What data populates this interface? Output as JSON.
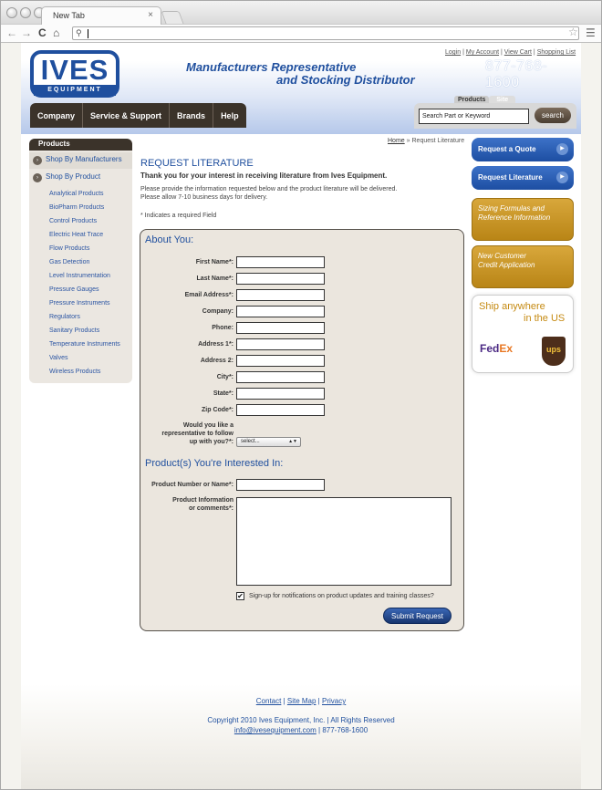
{
  "browser": {
    "tab_title": "New Tab",
    "tab_close": "×",
    "back": "←",
    "forward": "→",
    "reload": "C",
    "home": "⌂",
    "search_glyph": "⚲",
    "star": "☆",
    "menu": "☰"
  },
  "header": {
    "logo_main": "IVES",
    "logo_sub": "EQUIPMENT",
    "tagline_1": "Manufacturers Representative",
    "tagline_2": "and Stocking Distributor",
    "top_links": [
      "Login",
      "My Account",
      "View Cart",
      "Shopping List"
    ],
    "phone": "877-768-1600"
  },
  "nav": {
    "items": [
      "Company",
      "Service & Support",
      "Brands",
      "Help"
    ]
  },
  "search": {
    "tab_products": "Products",
    "tab_site": "Site",
    "placeholder": "Search Part or Keyword",
    "button": "search"
  },
  "sidebar": {
    "heading": "Products",
    "shop_manufacturers": "Shop By Manufacturers",
    "shop_product": "Shop By Product",
    "bullet": "›",
    "items": [
      "Analytical Products",
      "BioPharm Products",
      "Control Products",
      "Electric Heat Trace",
      "Flow Products",
      "Gas Detection",
      "Level Instrumentation",
      "Pressure Gauges",
      "Pressure Instruments",
      "Regulators",
      "Sanitary Products",
      "Temperature Instruments",
      "Valves",
      "Wireless Products"
    ]
  },
  "breadcrumb": {
    "home": "Home",
    "sep": "»",
    "current": "Request Literature"
  },
  "main": {
    "title": "REQUEST LITERATURE",
    "thanks": "Thank you for your interest in receiving literature from Ives Equipment.",
    "p1": "Please provide the information requested below and the product literature will be delivered.",
    "p2": "Please allow 7-10 business days for delivery.",
    "required_note": "* Indicates a required Field"
  },
  "form": {
    "about_heading": "About You:",
    "fields": [
      "First Name*:",
      "Last Name*:",
      "Email Address*:",
      "Company:",
      "Phone:",
      "Address 1*:",
      "Address 2:",
      "City*:",
      "State*:",
      "Zip Code*:"
    ],
    "rep_label_1": "Would you like a",
    "rep_label_2": "representative to follow",
    "rep_label_3": "up with you?*:",
    "select_value": "select...",
    "select_arrow": "▲▼",
    "products_heading": "Product(s) You're Interested In:",
    "product_number_label": "Product Number or Name*:",
    "product_info_label_1": "Product Information",
    "product_info_label_2": "or comments*:",
    "checkbox_mark": "✔",
    "checkbox_label": "Sign-up for notifications on product updates and training classes?",
    "submit": "Submit Request"
  },
  "right": {
    "quote": "Request a Quote",
    "literature": "Request Literature",
    "arrow": "▶",
    "sizing_1": "Sizing Formulas and",
    "sizing_2": "Reference Information",
    "credit_1": "New Customer",
    "credit_2": "Credit Application",
    "ship_1": "Ship anywhere",
    "ship_2": "in the US",
    "fedex_fed": "Fed",
    "fedex_ex": "Ex",
    "ups": "ups"
  },
  "footer": {
    "links": [
      "Contact",
      "Site Map",
      "Privacy"
    ],
    "copyright": "Copyright 2010 Ives Equipment, Inc. | All Rights Reserved",
    "email": "info@ivesequipment.com",
    "phone_line": " | 877-768-1600"
  },
  "colors": {
    "brand_blue": "#1f4f9e",
    "nav_brown": "#3b332a",
    "gold": "#c58a12"
  }
}
